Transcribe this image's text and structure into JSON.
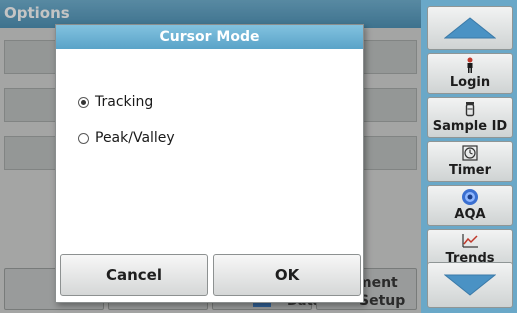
{
  "background": {
    "title": "Options",
    "bottom_buttons": [
      {
        "label": "",
        "sublabel": ""
      },
      {
        "label": "",
        "sublabel": "Data"
      },
      {
        "label": "ment",
        "sublabel": "Setup"
      }
    ]
  },
  "dialog": {
    "title": "Cursor Mode",
    "options": [
      {
        "label": "Tracking",
        "selected": true
      },
      {
        "label": "Peak/Valley",
        "selected": false
      }
    ],
    "cancel_label": "Cancel",
    "ok_label": "OK"
  },
  "sidebar": {
    "up_icon": "up-arrow-icon",
    "down_icon": "down-arrow-icon",
    "items": [
      {
        "label": "Login",
        "icon": "person-icon"
      },
      {
        "label": "Sample ID",
        "icon": "vial-icon"
      },
      {
        "label": "Timer",
        "icon": "timer-icon"
      },
      {
        "label": "AQA",
        "icon": "aqa-icon"
      },
      {
        "label": "Trends",
        "icon": "trends-icon"
      }
    ]
  },
  "colors": {
    "header_blue": "#5aa3c8",
    "sidebar_blue": "#6aa8c8",
    "arrow_blue": "#4a92c4"
  }
}
